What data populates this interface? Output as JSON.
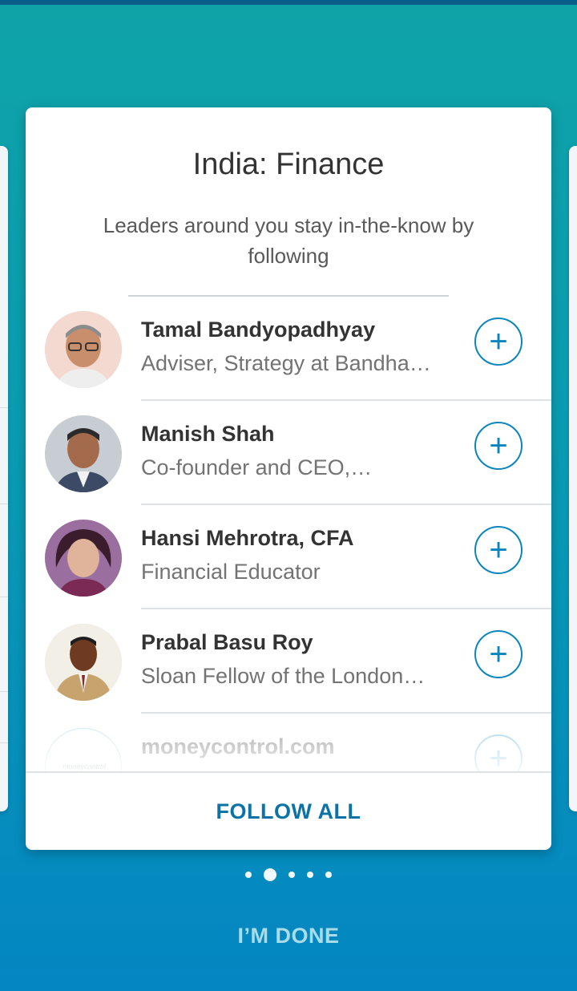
{
  "card": {
    "title": "India: Finance",
    "subtitle": "Leaders around you stay in-the-know by following"
  },
  "people": [
    {
      "name": "Tamal Bandyopadhyay",
      "headline": "Adviser, Strategy at Bandha…",
      "follow_icon": "+"
    },
    {
      "name": "Manish Shah",
      "headline": "Co-founder and CEO,…",
      "follow_icon": "+"
    },
    {
      "name": "Hansi Mehrotra, CFA",
      "headline": "Financial Educator",
      "follow_icon": "+"
    },
    {
      "name": "Prabal Basu Roy",
      "headline": "Sloan Fellow of the London…",
      "follow_icon": "+"
    },
    {
      "name": "moneycontrol.com",
      "headline": "",
      "follow_icon": "+",
      "logo_text": "moneycontrol"
    }
  ],
  "follow_all_label": "FOLLOW ALL",
  "pager": {
    "total": 5,
    "active_index": 1
  },
  "done_label": "I’M DONE",
  "colors": {
    "accent": "#0b85bd",
    "background_top": "#0fa3a8",
    "background_bottom": "#0486c2"
  }
}
